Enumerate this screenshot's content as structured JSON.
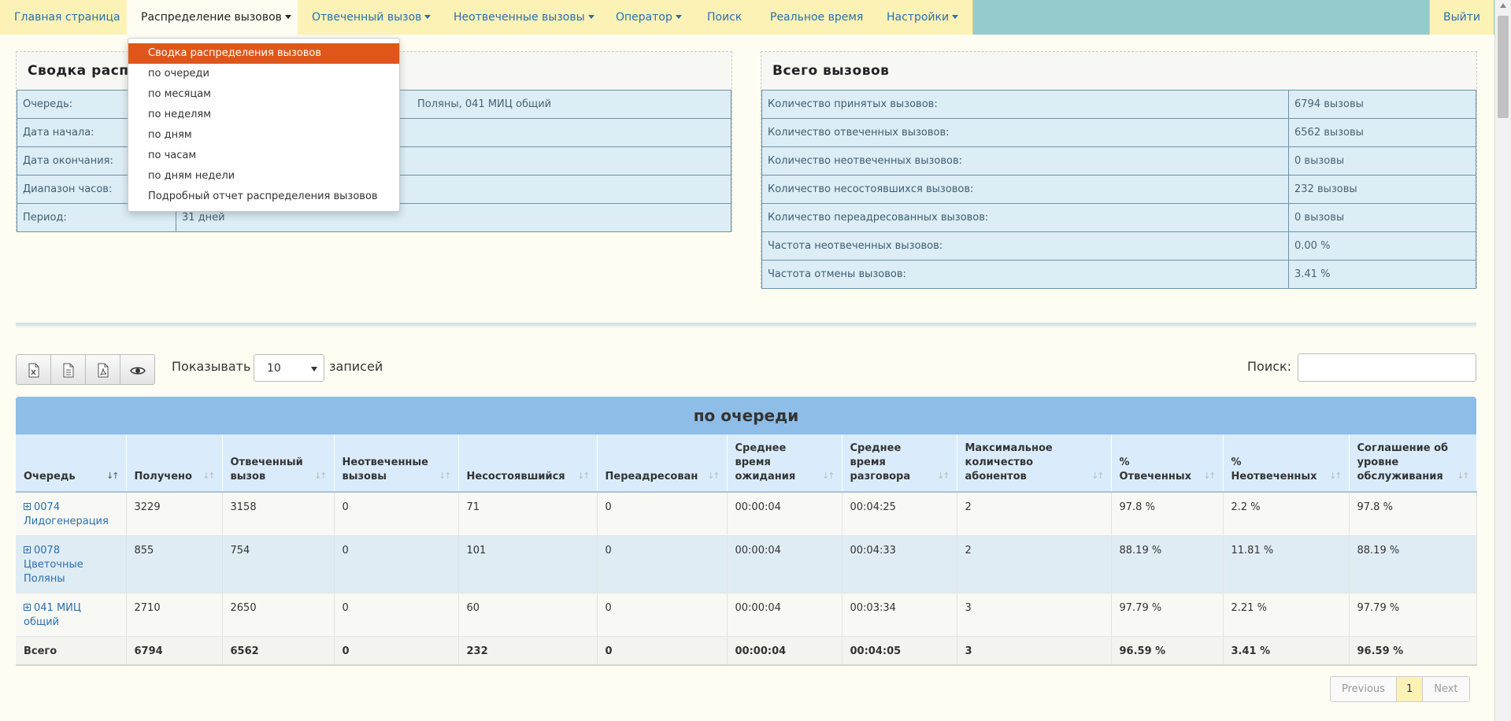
{
  "nav": {
    "tabs": [
      {
        "label": "Главная страница",
        "caret": false
      },
      {
        "label": "Распределение вызовов",
        "caret": true
      },
      {
        "label": "Отвеченный вызов",
        "caret": true
      },
      {
        "label": "Неотвеченные вызовы",
        "caret": true
      },
      {
        "label": "Оператор",
        "caret": true
      },
      {
        "label": "Поиск",
        "caret": false
      },
      {
        "label": "Реальное время",
        "caret": false
      },
      {
        "label": "Настройки",
        "caret": true
      }
    ],
    "logout": "Выйти"
  },
  "dropdown": {
    "items": [
      "Сводка распределения вызовов",
      "по очереди",
      "по месяцам",
      "по неделям",
      "по дням",
      "по часам",
      "по дням недели",
      "Подробный отчет распределения вызовов"
    ]
  },
  "summary": {
    "title": "Сводка распр",
    "rows": [
      {
        "label": "Очередь:",
        "value": "Поляны, 041 МИЦ общий"
      },
      {
        "label": "Дата начала:",
        "value": ""
      },
      {
        "label": "Дата окончания:",
        "value": ""
      },
      {
        "label": "Диапазон часов:",
        "value": ""
      },
      {
        "label": "Период:",
        "value": "31 дней"
      }
    ]
  },
  "totals": {
    "title": "Всего вызовов",
    "rows": [
      {
        "label": "Количество принятых вызовов:",
        "value": "6794 вызовы"
      },
      {
        "label": "Количество отвеченных вызовов:",
        "value": "6562 вызовы"
      },
      {
        "label": "Количество неотвеченных вызовов:",
        "value": "0 вызовы"
      },
      {
        "label": "Количество несостоявшихся вызовов:",
        "value": "232 вызовы"
      },
      {
        "label": "Количество переадресованных вызовов:",
        "value": "0 вызовы"
      },
      {
        "label": "Частота неотвеченных вызовов:",
        "value": "0.00 %"
      },
      {
        "label": "Частота отмены вызовов:",
        "value": "3.41 %"
      }
    ]
  },
  "toolbar": {
    "show_label": "Показывать",
    "length_value": "10",
    "records_label": "записей",
    "search_label": "Поиск:",
    "buttons": [
      "excel-export-icon",
      "csv-export-icon",
      "pdf-export-icon",
      "preview-eye-icon"
    ]
  },
  "table": {
    "title": "по очереди",
    "columns": [
      "Очередь",
      "Получено",
      "Отвеченный вызов",
      "Неотвеченные вызовы",
      "Несостоявшийся",
      "Переадресован",
      "Среднее время ожидания",
      "Среднее время разговора",
      "Максимальное количество абонентов",
      "% Отвеченных",
      "% Неотвеченных",
      "Соглашение об уровне обслуживания"
    ],
    "rows": [
      [
        "0074 Лидогенерация",
        "3229",
        "3158",
        "0",
        "71",
        "0",
        "00:00:04",
        "00:04:25",
        "2",
        "97.8 %",
        "2.2 %",
        "97.8 %"
      ],
      [
        "0078 Цветочные Поляны",
        "855",
        "754",
        "0",
        "101",
        "0",
        "00:00:04",
        "00:04:33",
        "2",
        "88.19 %",
        "11.81 %",
        "88.19 %"
      ],
      [
        "041 МИЦ общий",
        "2710",
        "2650",
        "0",
        "60",
        "0",
        "00:00:04",
        "00:03:34",
        "3",
        "97.79 %",
        "2.21 %",
        "97.79 %"
      ]
    ],
    "total": [
      "Всего",
      "6794",
      "6562",
      "0",
      "232",
      "0",
      "00:00:04",
      "00:04:05",
      "3",
      "96.59 %",
      "3.41 %",
      "96.59 %"
    ]
  },
  "pagination": {
    "previous": "Previous",
    "current": "1",
    "next": "Next"
  },
  "colors": {
    "accent": "#e0561a",
    "nav_bg": "#96cbcc",
    "tab_bg": "#fcf2b5",
    "link": "#2a6fae",
    "table_header": "#8ebde8"
  }
}
